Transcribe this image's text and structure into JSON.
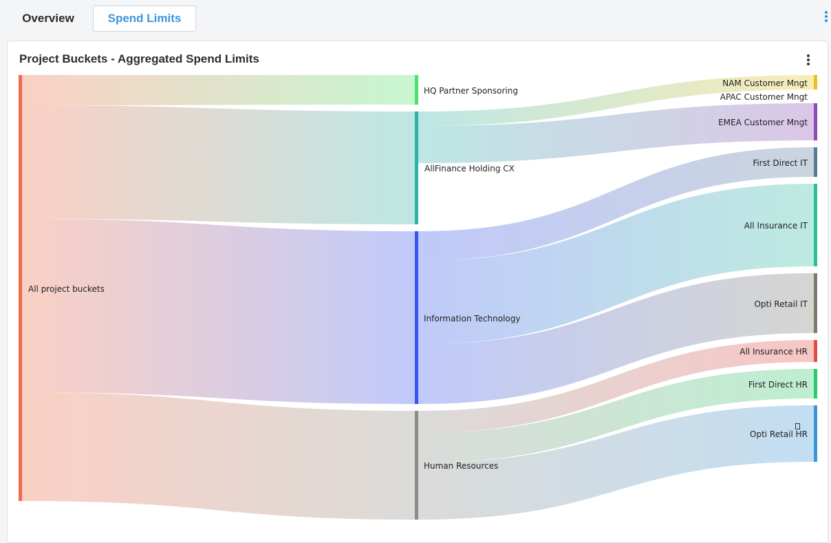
{
  "tabs": [
    {
      "label": "Overview"
    },
    {
      "label": "Spend Limits"
    }
  ],
  "card": {
    "title": "Project Buckets - Aggregated Spend Limits"
  },
  "chart_data": {
    "type": "sankey",
    "nodes": [
      {
        "id": "root",
        "label": "All project buckets",
        "color": "#f26a46"
      },
      {
        "id": "hq",
        "label": "HQ Partner Sponsoring",
        "color": "#4be267"
      },
      {
        "id": "afh",
        "label": "AllFinance Holding CX",
        "color": "#2fb1aa"
      },
      {
        "id": "it",
        "label": "Information Technology",
        "color": "#3657ee"
      },
      {
        "id": "hr",
        "label": "Human Resources",
        "color": "#8c8c86"
      },
      {
        "id": "nam",
        "label": "NAM Customer Mngt",
        "color": "#e8c21a"
      },
      {
        "id": "apac",
        "label": "APAC Customer Mngt",
        "color": "#f0f0f0"
      },
      {
        "id": "emea",
        "label": "EMEA Customer Mngt",
        "color": "#8e4cb6"
      },
      {
        "id": "fdit",
        "label": "First Direct IT",
        "color": "#5a7994"
      },
      {
        "id": "aiit",
        "label": "All Insurance IT",
        "color": "#2dbd9d"
      },
      {
        "id": "orit",
        "label": "Opti Retail IT",
        "color": "#7c7c6c"
      },
      {
        "id": "aihr",
        "label": "All Insurance HR",
        "color": "#e64c44"
      },
      {
        "id": "fdhr",
        "label": "First Direct HR",
        "color": "#2dc96d"
      },
      {
        "id": "orhr",
        "label": "Opti Retail HR",
        "color": "#3d95d6"
      }
    ],
    "links": [
      {
        "source": "root",
        "target": "hq",
        "value": 43
      },
      {
        "source": "root",
        "target": "afh",
        "value": 164
      },
      {
        "source": "root",
        "target": "it",
        "value": 252
      },
      {
        "source": "root",
        "target": "hr",
        "value": 158
      },
      {
        "source": "afh",
        "target": "nam",
        "value": 21
      },
      {
        "source": "afh",
        "target": "emea",
        "value": 54
      },
      {
        "source": "it",
        "target": "fdit",
        "value": 43
      },
      {
        "source": "it",
        "target": "aiit",
        "value": 121
      },
      {
        "source": "it",
        "target": "orit",
        "value": 87
      },
      {
        "source": "hr",
        "target": "aihr",
        "value": 32
      },
      {
        "source": "hr",
        "target": "fdhr",
        "value": 43
      },
      {
        "source": "hr",
        "target": "orhr",
        "value": 82
      }
    ]
  }
}
